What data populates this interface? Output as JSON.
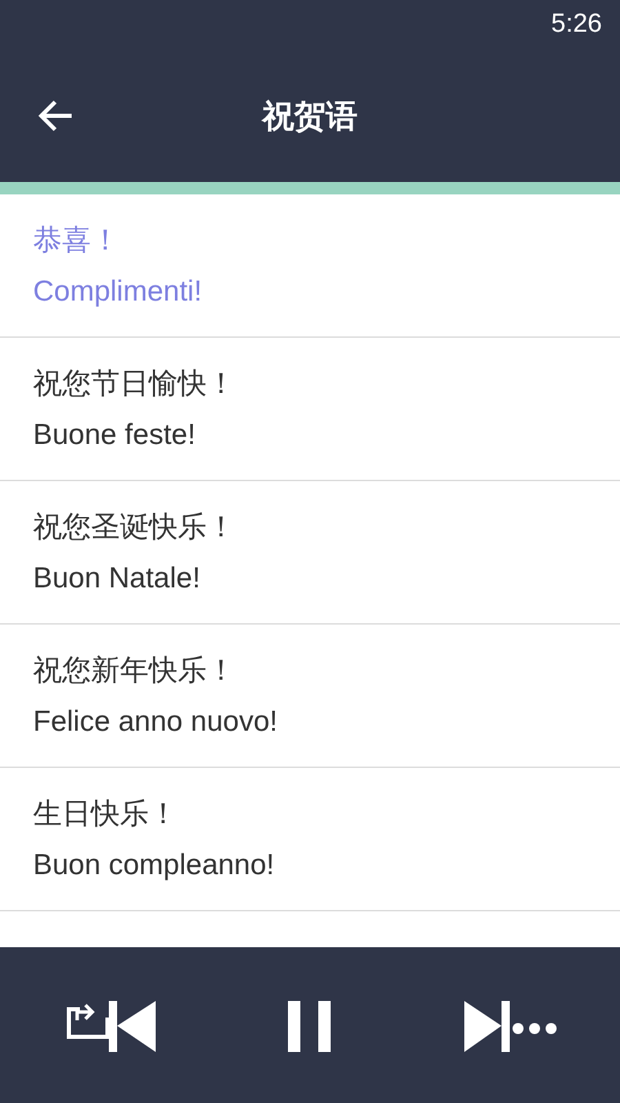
{
  "status_bar": {
    "time": "5:26"
  },
  "toolbar": {
    "title": "祝贺语"
  },
  "phrases": [
    {
      "chinese": "恭喜！",
      "italian": "Complimenti!",
      "selected": true
    },
    {
      "chinese": "祝您节日愉快！",
      "italian": "Buone feste!",
      "selected": false
    },
    {
      "chinese": "祝您圣诞快乐！",
      "italian": "Buon Natale!",
      "selected": false
    },
    {
      "chinese": "祝您新年快乐！",
      "italian": "Felice anno nuovo!",
      "selected": false
    },
    {
      "chinese": "生日快乐！",
      "italian": "Buon compleanno!",
      "selected": false
    }
  ],
  "player": {
    "playing": true
  }
}
